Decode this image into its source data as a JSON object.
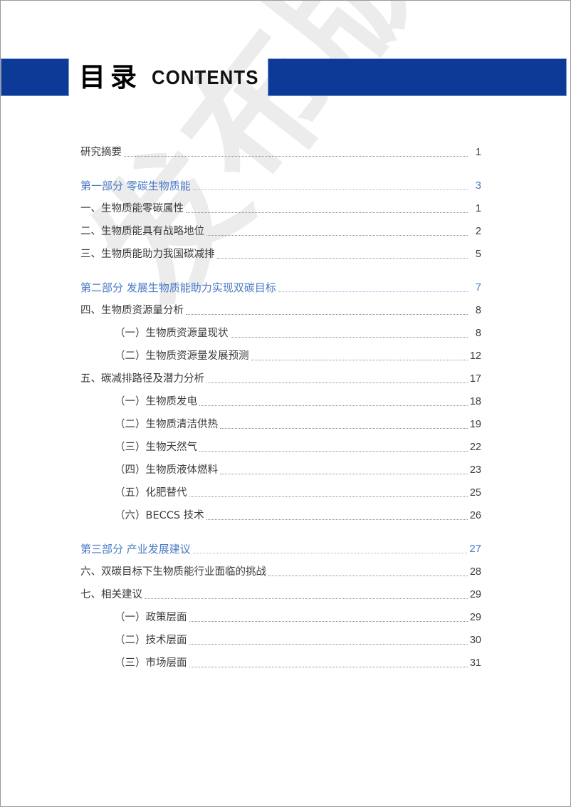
{
  "header": {
    "title_cn": "目录",
    "title_en": "CONTENTS",
    "bar_color": "#0c3a96",
    "accent_blue": "#4a7ac4"
  },
  "watermark": {
    "text": "发布版",
    "color": "#ececed"
  },
  "toc": {
    "entries": [
      {
        "label": "研究摘要",
        "page": "1",
        "level": "lvl-1",
        "spaced": false
      },
      {
        "label": "第一部分  零碳生物质能",
        "page": "3",
        "level": "lvl-part",
        "spaced": true
      },
      {
        "label": "一、生物质能零碳属性",
        "page": "1",
        "level": "lvl-1",
        "spaced": false
      },
      {
        "label": "二、生物质能具有战略地位",
        "page": "2",
        "level": "lvl-1",
        "spaced": false
      },
      {
        "label": "三、生物质能助力我国碳减排",
        "page": "5",
        "level": "lvl-1",
        "spaced": false
      },
      {
        "label": "第二部分  发展生物质能助力实现双碳目标",
        "page": "7",
        "level": "lvl-part",
        "spaced": true
      },
      {
        "label": "四、生物质资源量分析",
        "page": "8",
        "level": "lvl-1",
        "spaced": false
      },
      {
        "label": "（一）生物质资源量现状",
        "page": "8",
        "level": "lvl-2",
        "spaced": false
      },
      {
        "label": "（二）生物质资源量发展预测",
        "page": "12",
        "level": "lvl-2",
        "spaced": false
      },
      {
        "label": "五、碳减排路径及潜力分析",
        "page": "17",
        "level": "lvl-1",
        "spaced": false
      },
      {
        "label": "（一）生物质发电",
        "page": "18",
        "level": "lvl-2",
        "spaced": false
      },
      {
        "label": "（二）生物质清洁供热",
        "page": "19",
        "level": "lvl-2",
        "spaced": false
      },
      {
        "label": "（三）生物天然气",
        "page": "22",
        "level": "lvl-2",
        "spaced": false
      },
      {
        "label": "（四）生物质液体燃料",
        "page": "23",
        "level": "lvl-2",
        "spaced": false
      },
      {
        "label": "（五）化肥替代",
        "page": "25",
        "level": "lvl-2",
        "spaced": false
      },
      {
        "label": "（六）BECCS 技术",
        "page": "26",
        "level": "lvl-2",
        "spaced": false
      },
      {
        "label": "第三部分  产业发展建议",
        "page": "27",
        "level": "lvl-part",
        "spaced": true
      },
      {
        "label": "六、双碳目标下生物质能行业面临的挑战",
        "page": "28",
        "level": "lvl-1",
        "spaced": false
      },
      {
        "label": "七、相关建议",
        "page": "29",
        "level": "lvl-1",
        "spaced": false
      },
      {
        "label": "（一）政策层面",
        "page": "29",
        "level": "lvl-2",
        "spaced": false
      },
      {
        "label": "（二）技术层面",
        "page": "30",
        "level": "lvl-2",
        "spaced": false
      },
      {
        "label": "（三）市场层面",
        "page": "31",
        "level": "lvl-2",
        "spaced": false
      }
    ]
  }
}
